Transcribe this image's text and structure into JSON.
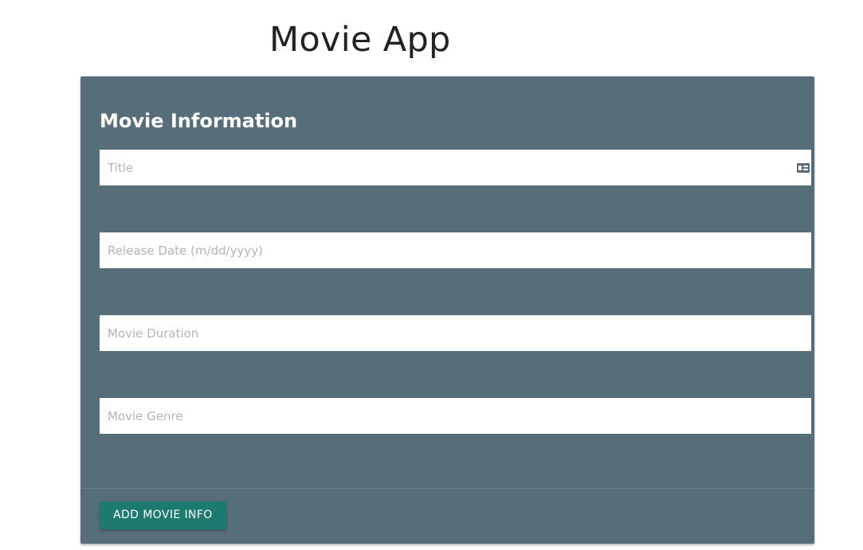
{
  "app": {
    "title": "Movie App"
  },
  "form": {
    "heading": "Movie Information",
    "fields": [
      {
        "placeholder": "Title",
        "value": "",
        "icon": "id-card-icon"
      },
      {
        "placeholder": "Release Date (m/dd/yyyy)",
        "value": ""
      },
      {
        "placeholder": "Movie Duration",
        "value": ""
      },
      {
        "placeholder": "Movie Genre",
        "value": ""
      }
    ],
    "submit_label": "ADD MOVIE INFO"
  },
  "colors": {
    "card_background": "#566e79",
    "button_background": "#1c7a70",
    "title_text": "#222222",
    "placeholder_text": "#b4b4b4"
  }
}
